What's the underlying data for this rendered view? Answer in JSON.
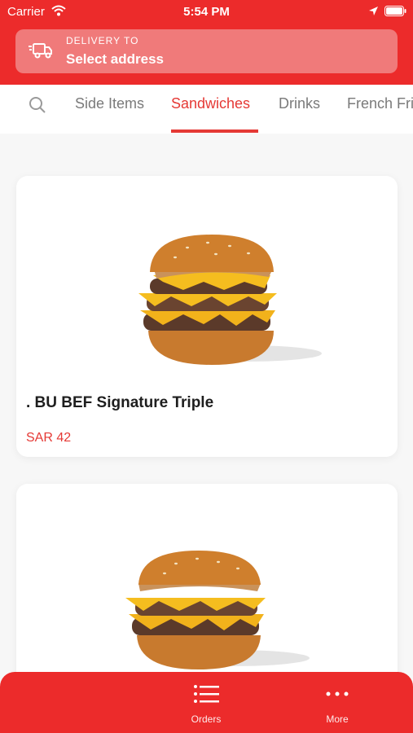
{
  "status_bar": {
    "carrier": "Carrier",
    "time": "5:54 PM"
  },
  "header": {
    "delivery_label": "DELIVERY TO",
    "address_text": "Select address",
    "background_color": "#ec2b2b"
  },
  "categories": {
    "tabs": [
      {
        "label": "Side Items"
      },
      {
        "label": "Sandwiches"
      },
      {
        "label": "Drinks"
      },
      {
        "label": "French Fri"
      }
    ],
    "active_tab": "Sandwiches"
  },
  "products": [
    {
      "name": ". BU BEF Signature Triple",
      "price": "SAR 42",
      "image": "burger-image"
    },
    {
      "image": "burger-image"
    }
  ],
  "bottom_nav": {
    "items": [
      {
        "label": "Orders",
        "icon": "list-icon"
      },
      {
        "label": "More",
        "icon": "more-dots-icon"
      }
    ]
  },
  "colors": {
    "accent": "#e53935",
    "header_red": "#ec2b2b"
  }
}
